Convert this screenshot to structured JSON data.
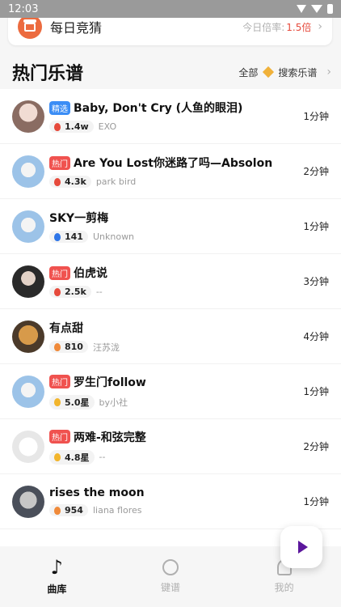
{
  "status_bar": {
    "time": "12:03"
  },
  "daily": {
    "title": "每日竞猜",
    "rate_label": "今日倍率:",
    "rate_value": "1.5倍"
  },
  "section": {
    "title": "热门乐谱",
    "all_label": "全部",
    "search_label": "搜索乐谱"
  },
  "songs": [
    {
      "tag": "精选",
      "tag_color": "#3b8df5",
      "title": "Baby, Don't Cry (人鱼的眼泪)",
      "stat": "1.4w",
      "stat_icon": "fire-icon",
      "stat_color": "#e64a3c",
      "artist": "EXO",
      "duration": "1分钟"
    },
    {
      "tag": "热门",
      "tag_color": "#f0524f",
      "title": "Are You Lost你迷路了吗—Absolon",
      "stat": "4.3k",
      "stat_icon": "fire-icon",
      "stat_color": "#e64a3c",
      "artist": "park bird",
      "duration": "2分钟"
    },
    {
      "tag": "",
      "tag_color": "",
      "title": "SKY一剪梅",
      "stat": "141",
      "stat_icon": "drop-icon",
      "stat_color": "#2f76e8",
      "artist": "Unknown",
      "duration": "1分钟"
    },
    {
      "tag": "热门",
      "tag_color": "#f0524f",
      "title": "伯虎说",
      "stat": "2.5k",
      "stat_icon": "fire-icon",
      "stat_color": "#e64a3c",
      "artist": "--",
      "duration": "3分钟"
    },
    {
      "tag": "",
      "tag_color": "",
      "title": "有点甜",
      "stat": "810",
      "stat_icon": "fire-icon",
      "stat_color": "#f08a3a",
      "artist": "汪苏泷",
      "duration": "4分钟"
    },
    {
      "tag": "热门",
      "tag_color": "#f0524f",
      "title": "罗生门follow",
      "stat": "5.0星",
      "stat_icon": "thumb-icon",
      "stat_color": "#f2b52c",
      "artist": "by小社",
      "duration": "1分钟"
    },
    {
      "tag": "热门",
      "tag_color": "#f0524f",
      "title": "两难-和弦完整",
      "stat": "4.8星",
      "stat_icon": "thumb-icon",
      "stat_color": "#f2b52c",
      "artist": "--",
      "duration": "2分钟"
    },
    {
      "tag": "",
      "tag_color": "",
      "title": "rises the moon",
      "stat": "954",
      "stat_icon": "fire-icon",
      "stat_color": "#f08a3a",
      "artist": "liana flores",
      "duration": "1分钟"
    }
  ],
  "tabs": [
    {
      "label": "曲库",
      "icon": "music-note-icon",
      "active": true
    },
    {
      "label": "键谱",
      "icon": "keyboard-icon",
      "active": false
    },
    {
      "label": "我的",
      "icon": "profile-icon",
      "active": false
    }
  ],
  "colors": {
    "accent": "#e64a3c",
    "play": "#5b169c",
    "tab_active": "#111111",
    "tab_inactive": "#b0b0b0"
  }
}
